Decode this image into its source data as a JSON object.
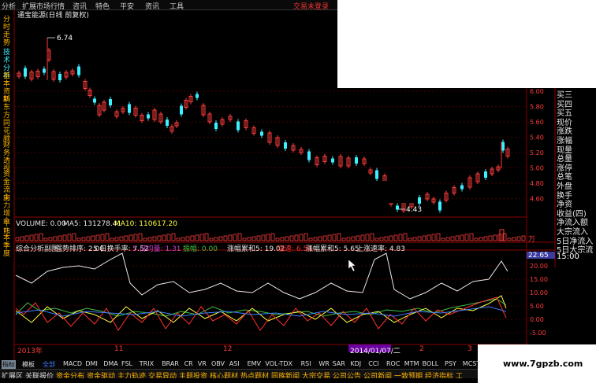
{
  "menu": {
    "items": [
      "分析",
      "扩展市场行情",
      "咨讯",
      "特色",
      "平安",
      "资讯",
      "工具"
    ],
    "login_status": "交易未登录"
  },
  "left_tabs": [
    "分时走势",
    "技术分析",
    "基本资料",
    "新东方",
    "同花顺",
    "财务透视",
    "资金流向",
    "主力增仓",
    "牛熊",
    "本季度"
  ],
  "chart_title": "通宝能源(日线 前复权)",
  "price_axis": [
    "6.00",
    "5.80",
    "5.60",
    "5.40",
    "5.20",
    "5.00",
    "4.80",
    "4.60"
  ],
  "annotations": {
    "high": "6.74",
    "low": "4.43"
  },
  "volume": {
    "label": "VOLUME: 0.00",
    "ma5": "MA5: 131278.41",
    "ma10": "MA10: 110617.20",
    "axis": "万"
  },
  "indicator": {
    "name": "综合分析副图",
    "items": [
      {
        "text": "强势排序: 2.00",
        "color": "#e8e8e8"
      },
      {
        "text": "5 日换手率: 7.52",
        "color": "#e8e8e8"
      },
      {
        "text": "5 日均量: 1.31",
        "color": "#d040d0"
      },
      {
        "text": "振幅: 0.00",
        "color": "#40c040"
      },
      {
        "text": "涨幅累和5: 19.02",
        "color": "#e8e8e8"
      },
      {
        "text": "涨速: 6.54",
        "color": "#ff3030"
      },
      {
        "text": "涨幅累和5: 5.65",
        "color": "#e8e8e8"
      },
      {
        "text": "上涨速率: 4.83",
        "color": "#e8e8e8"
      }
    ],
    "axis": [
      "20.00",
      "15.00",
      "10.00",
      "5.00",
      "0.00",
      "-5.00"
    ],
    "badge": "22.65"
  },
  "right_panel": [
    "买三",
    "买四",
    "买五",
    "现价",
    "涨跌",
    "涨幅",
    "现量",
    "总量",
    "涨停",
    "总笔",
    "外盘",
    "换手",
    "净资",
    "收益(四)",
    "净流入额",
    "大宗流入",
    "5日净流入",
    "5日大宗流",
    "15:00"
  ],
  "timeline": {
    "labels": [
      "2013年",
      "11",
      "12",
      "2014/01/07/二",
      "2",
      "3"
    ]
  },
  "bottom_tabs": [
    "指标",
    "模板",
    "全部",
    "MACD",
    "DMI",
    "DMA",
    "FSL",
    "TRIX",
    "BRAR",
    "CR",
    "VR",
    "OBV",
    "ASI",
    "EMV",
    "VOL-TDX",
    "RSI",
    "WR",
    "SAR",
    "KDJ",
    "CCI",
    "ROC",
    "MTM",
    "BOLL",
    "PSY",
    "MCST"
  ],
  "bottom_nav": [
    "扩展区",
    "关联报价",
    "资金分布",
    "资金驱动",
    "主力轨迹",
    "交易异动",
    "主题投资",
    "核心题材",
    "热点题材",
    "同族新闻",
    "大宗交易",
    "公司公告",
    "公司新闻",
    "一致预期",
    "经济指标",
    "工"
  ],
  "watermark": "www.7gpzb.com",
  "colors": {
    "up": "#ff3c3c",
    "down": "#3cf0ff",
    "ma": "#e8e8e8",
    "accent": "#ffb400"
  }
}
